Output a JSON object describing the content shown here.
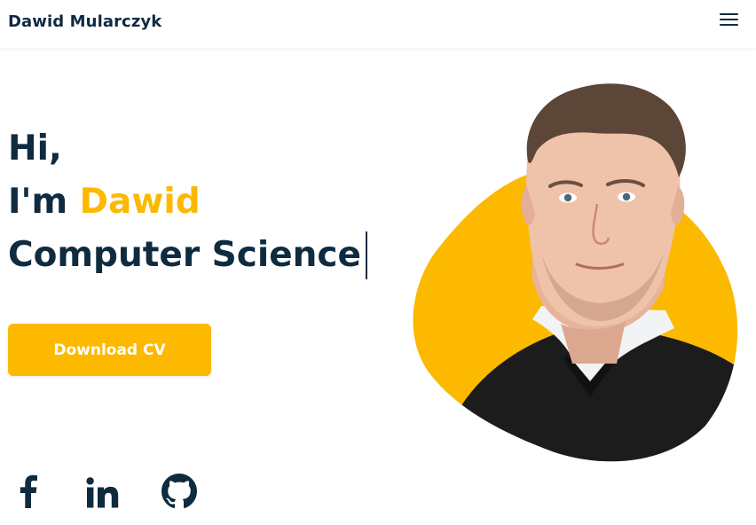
{
  "header": {
    "brand": "Dawid Mularczyk",
    "menu_icon": "hamburger-menu-icon"
  },
  "hero": {
    "greeting": "Hi,",
    "intro_prefix": "I'm",
    "name": "Dawid",
    "role": "Computer Science"
  },
  "cta": {
    "download_label": "Download CV"
  },
  "social": {
    "facebook_icon": "facebook-icon",
    "linkedin_icon": "linkedin-icon",
    "github_icon": "github-icon"
  },
  "colors": {
    "accent": "#fcb900",
    "text_dark": "#0f2b3f",
    "background": "#ffffff"
  }
}
